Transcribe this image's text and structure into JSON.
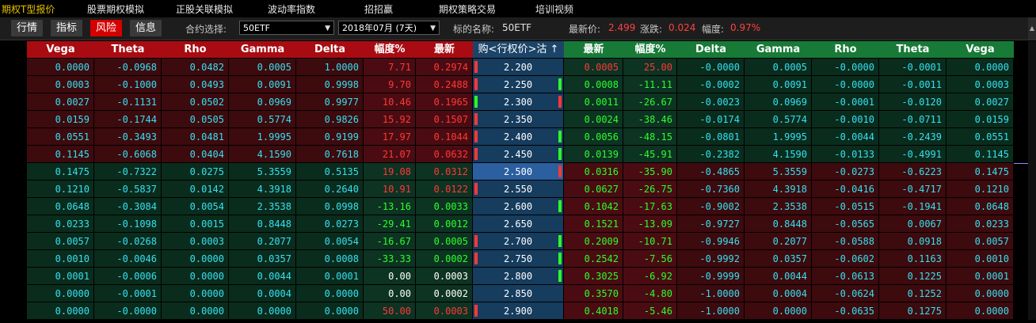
{
  "menu": [
    {
      "label": "期权T型报价",
      "active": true
    },
    {
      "label": "股票期权模拟",
      "active": false
    },
    {
      "label": "正股关联模拟",
      "active": false
    },
    {
      "label": "波动率指数",
      "active": false
    },
    {
      "label": "招招赢",
      "active": false
    },
    {
      "label": "期权策略交易",
      "active": false
    },
    {
      "label": "培训视频",
      "active": false
    }
  ],
  "view_tabs": [
    {
      "label": "行情",
      "active": false
    },
    {
      "label": "指标",
      "active": false
    },
    {
      "label": "风险",
      "active": true
    },
    {
      "label": "信息",
      "active": false
    }
  ],
  "toolbar": {
    "contract_label": "合约选择:",
    "contract_value": "50ETF",
    "month_value": "2018年07月 (7天)",
    "underlying_label": "标的名称:",
    "underlying_value": "50ETF",
    "last_label": "最新价:",
    "last_value": "2.499",
    "change_label": "涨跌:",
    "change_value": "0.024",
    "pct_label": "幅度:",
    "pct_value": "0.97%",
    "dropdown_arrow": "▼"
  },
  "colors": {
    "call_header": "#a80c12",
    "put_header": "#177a37",
    "strike_cell": "#163c5e",
    "selected_strike": "#2b5fa0",
    "red": "#ff3838",
    "green": "#2bff2b",
    "cyan": "#35e0f0"
  },
  "headers": {
    "call": [
      "Vega",
      "Theta",
      "Rho",
      "Gamma",
      "Delta",
      "幅度%",
      "最新"
    ],
    "strike": "购<行权价>沽 ↑",
    "put": [
      "最新",
      "幅度%",
      "Delta",
      "Gamma",
      "Rho",
      "Theta",
      "Vega"
    ]
  },
  "selected_strike": "2.500",
  "rows": [
    {
      "call": [
        "0.0000",
        "-0.0968",
        "0.0482",
        "0.0005",
        "1.0000",
        "7.71",
        "0.2974"
      ],
      "strike": "2.200",
      "put": [
        "0.0005",
        "25.00",
        "-0.0000",
        "0.0005",
        "-0.0000",
        "-0.0001",
        "0.0000"
      ],
      "call_ind": "red",
      "put_ind": "none",
      "call_dir": "red",
      "put_dir": "red"
    },
    {
      "call": [
        "0.0003",
        "-0.1000",
        "0.0493",
        "0.0091",
        "0.9998",
        "9.70",
        "0.2488"
      ],
      "strike": "2.250",
      "put": [
        "0.0008",
        "-11.11",
        "-0.0002",
        "0.0091",
        "-0.0000",
        "-0.0011",
        "0.0003"
      ],
      "call_ind": "red",
      "put_ind": "green",
      "call_dir": "red",
      "put_dir": "green"
    },
    {
      "call": [
        "0.0027",
        "-0.1131",
        "0.0502",
        "0.0969",
        "0.9977",
        "10.46",
        "0.1965"
      ],
      "strike": "2.300",
      "put": [
        "0.0011",
        "-26.67",
        "-0.0023",
        "0.0969",
        "-0.0001",
        "-0.0120",
        "0.0027"
      ],
      "call_ind": "green",
      "put_ind": "red",
      "call_dir": "red",
      "put_dir": "green"
    },
    {
      "call": [
        "0.0159",
        "-0.1744",
        "0.0505",
        "0.5774",
        "0.9826",
        "15.92",
        "0.1507"
      ],
      "strike": "2.350",
      "put": [
        "0.0024",
        "-38.46",
        "-0.0174",
        "0.5774",
        "-0.0010",
        "-0.0711",
        "0.0159"
      ],
      "call_ind": "red",
      "put_ind": "none",
      "call_dir": "red",
      "put_dir": "green"
    },
    {
      "call": [
        "0.0551",
        "-0.3493",
        "0.0481",
        "1.9995",
        "0.9199",
        "17.97",
        "0.1044"
      ],
      "strike": "2.400",
      "put": [
        "0.0056",
        "-48.15",
        "-0.0801",
        "1.9995",
        "-0.0044",
        "-0.2439",
        "0.0551"
      ],
      "call_ind": "red",
      "put_ind": "green",
      "call_dir": "red",
      "put_dir": "green"
    },
    {
      "call": [
        "0.1145",
        "-0.6068",
        "0.0404",
        "4.1590",
        "0.7618",
        "21.07",
        "0.0632"
      ],
      "strike": "2.450",
      "put": [
        "0.0139",
        "-45.91",
        "-0.2382",
        "4.1590",
        "-0.0133",
        "-0.4991",
        "0.1145"
      ],
      "call_ind": "red",
      "put_ind": "green",
      "call_dir": "red",
      "put_dir": "green"
    },
    {
      "call": [
        "0.1475",
        "-0.7322",
        "0.0275",
        "5.3559",
        "0.5135",
        "19.08",
        "0.0312"
      ],
      "strike": "2.500",
      "put": [
        "0.0316",
        "-35.90",
        "-0.4865",
        "5.3559",
        "-0.0273",
        "-0.6223",
        "0.1475"
      ],
      "call_ind": "none",
      "put_ind": "red",
      "call_dir": "red",
      "put_dir": "green"
    },
    {
      "call": [
        "0.1210",
        "-0.5837",
        "0.0142",
        "4.3918",
        "0.2640",
        "10.91",
        "0.0122"
      ],
      "strike": "2.550",
      "put": [
        "0.0627",
        "-26.75",
        "-0.7360",
        "4.3918",
        "-0.0416",
        "-0.4717",
        "0.1210"
      ],
      "call_ind": "red",
      "put_ind": "none",
      "call_dir": "red",
      "put_dir": "green"
    },
    {
      "call": [
        "0.0648",
        "-0.3084",
        "0.0054",
        "2.3538",
        "0.0998",
        "-13.16",
        "0.0033"
      ],
      "strike": "2.600",
      "put": [
        "0.1042",
        "-17.63",
        "-0.9002",
        "2.3538",
        "-0.0515",
        "-0.1941",
        "0.0648"
      ],
      "call_ind": "none",
      "put_ind": "green",
      "call_dir": "green",
      "put_dir": "green"
    },
    {
      "call": [
        "0.0233",
        "-0.1098",
        "0.0015",
        "0.8448",
        "0.0273",
        "-29.41",
        "0.0012"
      ],
      "strike": "2.650",
      "put": [
        "0.1521",
        "-13.09",
        "-0.9727",
        "0.8448",
        "-0.0565",
        "0.0067",
        "0.0233"
      ],
      "call_ind": "none",
      "put_ind": "none",
      "call_dir": "green",
      "put_dir": "green"
    },
    {
      "call": [
        "0.0057",
        "-0.0268",
        "0.0003",
        "0.2077",
        "0.0054",
        "-16.67",
        "0.0005"
      ],
      "strike": "2.700",
      "put": [
        "0.2009",
        "-10.71",
        "-0.9946",
        "0.2077",
        "-0.0588",
        "0.0918",
        "0.0057"
      ],
      "call_ind": "red",
      "put_ind": "green",
      "call_dir": "green",
      "put_dir": "green"
    },
    {
      "call": [
        "0.0010",
        "-0.0046",
        "0.0000",
        "0.0357",
        "0.0008",
        "-33.33",
        "0.0002"
      ],
      "strike": "2.750",
      "put": [
        "0.2542",
        "-7.56",
        "-0.9992",
        "0.0357",
        "-0.0602",
        "0.1163",
        "0.0010"
      ],
      "call_ind": "red",
      "put_ind": "green",
      "call_dir": "green",
      "put_dir": "green"
    },
    {
      "call": [
        "0.0001",
        "-0.0006",
        "0.0000",
        "0.0044",
        "0.0001",
        "0.00",
        "0.0003"
      ],
      "strike": "2.800",
      "put": [
        "0.3025",
        "-6.92",
        "-0.9999",
        "0.0044",
        "-0.0613",
        "0.1225",
        "0.0001"
      ],
      "call_ind": "none",
      "put_ind": "green",
      "call_dir": "white",
      "put_dir": "green"
    },
    {
      "call": [
        "0.0000",
        "-0.0001",
        "0.0000",
        "0.0004",
        "0.0000",
        "0.00",
        "0.0002"
      ],
      "strike": "2.850",
      "put": [
        "0.3570",
        "-4.80",
        "-1.0000",
        "0.0004",
        "-0.0624",
        "0.1252",
        "0.0000"
      ],
      "call_ind": "none",
      "put_ind": "none",
      "call_dir": "white",
      "put_dir": "green"
    },
    {
      "call": [
        "0.0000",
        "-0.0000",
        "0.0000",
        "0.0000",
        "0.0000",
        "50.00",
        "0.0003"
      ],
      "strike": "2.900",
      "put": [
        "0.4018",
        "-5.46",
        "-1.0000",
        "0.0000",
        "-0.0635",
        "0.1275",
        "0.0000"
      ],
      "call_ind": "red",
      "put_ind": "none",
      "call_dir": "red",
      "put_dir": "green"
    }
  ]
}
